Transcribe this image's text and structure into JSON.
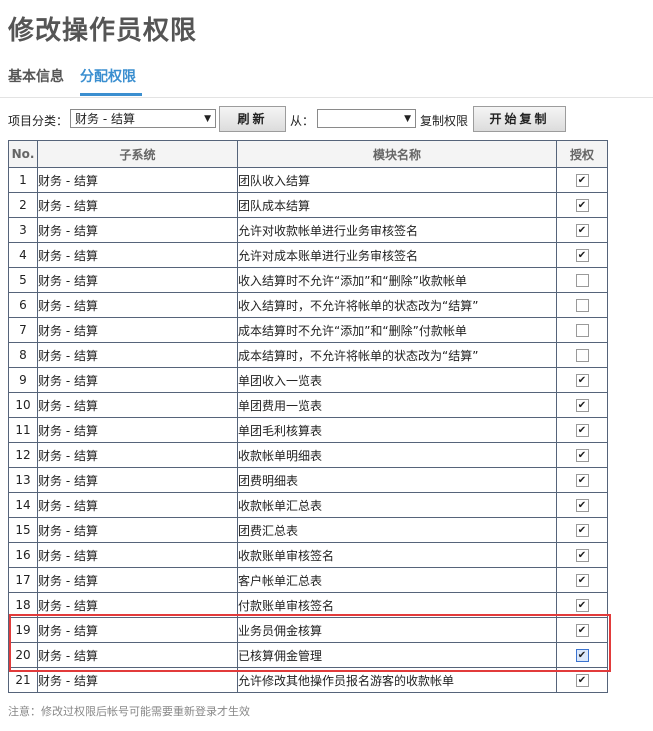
{
  "page": {
    "title": "修改操作员权限"
  },
  "tabs": [
    {
      "label": "基本信息",
      "active": false
    },
    {
      "label": "分配权限",
      "active": true
    }
  ],
  "toolbar": {
    "category_label": "项目分类：",
    "category_value": "财务 - 结算",
    "refresh_label": "刷新",
    "from_label": "从：",
    "from_value": "",
    "copy_label": "复制权限",
    "start_copy_label": "开始复制"
  },
  "table": {
    "headers": {
      "no": "No.",
      "subsystem": "子系统",
      "module": "模块名称",
      "auth": "授权"
    },
    "rows": [
      {
        "no": "1",
        "subsystem": "财务 - 结算",
        "module": "团队收入结算",
        "checked": true
      },
      {
        "no": "2",
        "subsystem": "财务 - 结算",
        "module": "团队成本结算",
        "checked": true
      },
      {
        "no": "3",
        "subsystem": "财务 - 结算",
        "module": "允许对收款帐单进行业务审核签名",
        "checked": true
      },
      {
        "no": "4",
        "subsystem": "财务 - 结算",
        "module": "允许对成本账单进行业务审核签名",
        "checked": true
      },
      {
        "no": "5",
        "subsystem": "财务 - 结算",
        "module": "收入结算时不允许“添加”和“删除”收款帐单",
        "checked": false
      },
      {
        "no": "6",
        "subsystem": "财务 - 结算",
        "module": "收入结算时，不允许将帐单的状态改为“结算”",
        "checked": false
      },
      {
        "no": "7",
        "subsystem": "财务 - 结算",
        "module": "成本结算时不允许“添加”和“删除”付款帐单",
        "checked": false
      },
      {
        "no": "8",
        "subsystem": "财务 - 结算",
        "module": "成本结算时，不允许将帐单的状态改为“结算”",
        "checked": false
      },
      {
        "no": "9",
        "subsystem": "财务 - 结算",
        "module": "单团收入一览表",
        "checked": true
      },
      {
        "no": "10",
        "subsystem": "财务 - 结算",
        "module": "单团费用一览表",
        "checked": true
      },
      {
        "no": "11",
        "subsystem": "财务 - 结算",
        "module": "单团毛利核算表",
        "checked": true
      },
      {
        "no": "12",
        "subsystem": "财务 - 结算",
        "module": "收款帐单明细表",
        "checked": true
      },
      {
        "no": "13",
        "subsystem": "财务 - 结算",
        "module": "团费明细表",
        "checked": true
      },
      {
        "no": "14",
        "subsystem": "财务 - 结算",
        "module": "收款帐单汇总表",
        "checked": true
      },
      {
        "no": "15",
        "subsystem": "财务 - 结算",
        "module": "团费汇总表",
        "checked": true
      },
      {
        "no": "16",
        "subsystem": "财务 - 结算",
        "module": "收款账单审核签名",
        "checked": true
      },
      {
        "no": "17",
        "subsystem": "财务 - 结算",
        "module": "客户帐单汇总表",
        "checked": true
      },
      {
        "no": "18",
        "subsystem": "财务 - 结算",
        "module": "付款账单审核签名",
        "checked": true
      },
      {
        "no": "19",
        "subsystem": "财务 - 结算",
        "module": "业务员佣金核算",
        "checked": true
      },
      {
        "no": "20",
        "subsystem": "财务 - 结算",
        "module": "已核算佣金管理",
        "checked": true,
        "focused": true
      },
      {
        "no": "21",
        "subsystem": "财务 - 结算",
        "module": "允许修改其他操作员报名游客的收款帐单",
        "checked": true
      }
    ]
  },
  "note": "注意：修改过权限后帐号可能需要重新登录才生效",
  "colors": {
    "accent": "#3b8fd0",
    "highlight": "#e23b3b"
  }
}
